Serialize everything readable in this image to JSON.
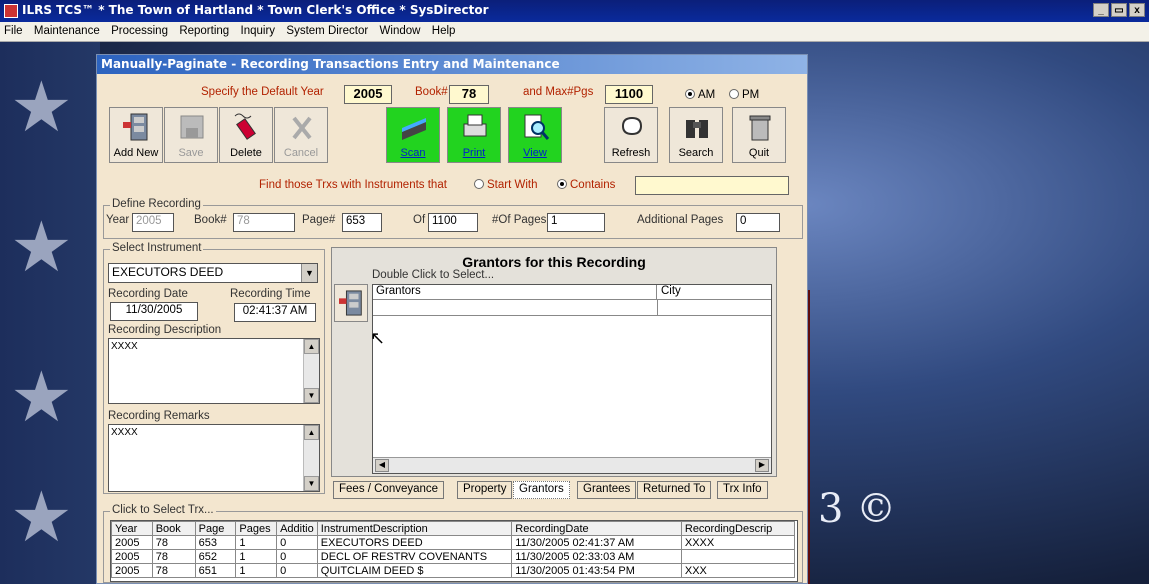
{
  "app": {
    "title": "ILRS TCS™ * The Town of Hartland * Town Clerk's Office * SysDirector",
    "win_controls": [
      "_",
      " ",
      "x"
    ]
  },
  "menu": [
    "File",
    "Maintenance",
    "Processing",
    "Reporting",
    "Inquiry",
    "System Director",
    "Window",
    "Help"
  ],
  "desktop": {
    "watermark": "3 ©"
  },
  "window": {
    "title": "Manually-Paginate - Recording Transactions Entry and Maintenance",
    "header": {
      "default_year_label": "Specify the Default Year",
      "default_year": "2005",
      "book_label": "Book#",
      "book": "78",
      "maxpgs_label": "and Max#Pgs",
      "maxpgs": "1100",
      "am_label": "AM",
      "pm_label": "PM",
      "am_selected": true
    },
    "toolbar": {
      "add_new": "Add New",
      "save": "Save",
      "delete": "Delete",
      "cancel": "Cancel",
      "scan": "Scan",
      "print": "Print",
      "view": "View",
      "refresh": "Refresh",
      "search": "Search",
      "quit": "Quit"
    },
    "find": {
      "label": "Find those Trxs with Instruments that",
      "start_with": "Start With",
      "contains": "Contains",
      "value": ""
    },
    "define": {
      "group": "Define Recording",
      "year_label": "Year",
      "year": "2005",
      "book_label": "Book#",
      "book": "78",
      "page_label": "Page#",
      "page": "653",
      "of_label": "Of",
      "of": "1100",
      "num_pages_label": "#Of Pages",
      "num_pages": "1",
      "additional_label": "Additional Pages",
      "additional": "0"
    },
    "instrument": {
      "group": "Select Instrument",
      "value": "EXECUTORS DEED",
      "recording_date_label": "Recording Date",
      "recording_date": "11/30/2005",
      "recording_time_label": "Recording Time",
      "recording_time": "02:41:37 AM",
      "description_label": "Recording Description",
      "description": "XXXX",
      "remarks_label": "Recording Remarks",
      "remarks": "XXXX"
    },
    "grantors": {
      "title": "Grantors for this Recording",
      "hint": "Double Click to Select...",
      "columns": [
        "Grantors",
        "City"
      ]
    },
    "tabs": [
      "Fees / Conveyance",
      "Property",
      "Grantors",
      "Grantees",
      "Returned To",
      "Trx Info"
    ],
    "active_tab": "Grantors",
    "trx": {
      "label": "Click to Select Trx...",
      "columns": [
        "Year",
        "Book",
        "Page",
        "Pages",
        "Additio",
        "InstrumentDescription",
        "RecordingDate",
        "RecordingDescrip"
      ],
      "rows": [
        [
          "2005",
          "78",
          "653",
          "1",
          "0",
          "EXECUTORS DEED",
          "11/30/2005 02:41:37 AM",
          "XXXX"
        ],
        [
          "2005",
          "78",
          "652",
          "1",
          "0",
          "DECL OF RESTRV COVENANTS",
          "11/30/2005 02:33:03 AM",
          ""
        ],
        [
          "2005",
          "78",
          "651",
          "1",
          "0",
          "QUITCLAIM DEED $",
          "11/30/2005 01:43:54 PM",
          "XXX"
        ]
      ]
    }
  }
}
